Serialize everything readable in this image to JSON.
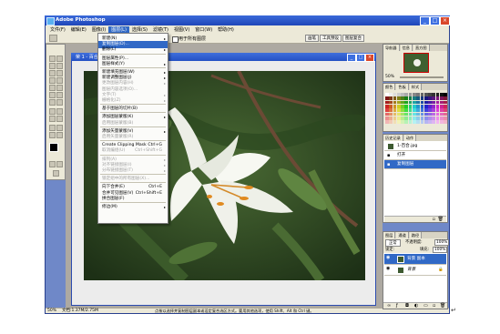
{
  "window": {
    "title": "Adobe Photoshop",
    "controls": [
      "_",
      "□",
      "×"
    ]
  },
  "menubar": {
    "items": [
      "文件(F)",
      "编辑(E)",
      "图像(I)",
      "图层(L)",
      "选择(S)",
      "滤镜(T)",
      "视图(V)",
      "窗口(W)",
      "帮助(H)"
    ],
    "active_index": 3
  },
  "options_bar": {
    "checkbox_label": "用于所有图层",
    "tabs": [
      "画笔",
      "工具预设",
      "图层复合"
    ]
  },
  "document": {
    "title": "荣 1 - 百合.jpg @ 50% (复制图层, RGB/8)"
  },
  "layer_menu": {
    "items": [
      {
        "label": "新建(N)",
        "arrow": true
      },
      {
        "label": "复制图层(D)...",
        "highlight": true
      },
      {
        "label": "删除(L)",
        "arrow": true
      },
      {
        "sep": true
      },
      {
        "label": "图层属性(P)..."
      },
      {
        "label": "图层样式(Y)",
        "arrow": true
      },
      {
        "sep": true
      },
      {
        "label": "新建填充图层(W)",
        "arrow": true
      },
      {
        "label": "新建调整图层(J)",
        "arrow": true
      },
      {
        "label": "更改图层内容(H)",
        "arrow": true,
        "disabled": true
      },
      {
        "label": "图层内容选项(O)...",
        "disabled": true
      },
      {
        "label": "文字(T)",
        "arrow": true,
        "disabled": true
      },
      {
        "label": "栅格化(Z)",
        "arrow": true,
        "disabled": true
      },
      {
        "sep": true
      },
      {
        "label": "基于图层的切片(B)"
      },
      {
        "sep": true
      },
      {
        "label": "添加图层蒙版(K)",
        "arrow": true
      },
      {
        "label": "启用图层蒙版(B)",
        "disabled": true
      },
      {
        "sep": true
      },
      {
        "label": "添加矢量蒙版(V)",
        "arrow": true
      },
      {
        "label": "启用矢量蒙版(R)",
        "disabled": true
      },
      {
        "sep": true
      },
      {
        "label": "Create Clipping Mask",
        "shortcut": "Ctrl+G"
      },
      {
        "label": "取消编组(U)",
        "shortcut": "Ctrl+Shift+G",
        "disabled": true
      },
      {
        "sep": true
      },
      {
        "label": "排列(A)",
        "arrow": true,
        "disabled": true
      },
      {
        "label": "对齐链接图层(I)",
        "arrow": true,
        "disabled": true
      },
      {
        "label": "分布链接图层(T)",
        "arrow": true,
        "disabled": true
      },
      {
        "sep": true
      },
      {
        "label": "锁定组中的所有图层(X)...",
        "disabled": true
      },
      {
        "sep": true
      },
      {
        "label": "向下合并(E)",
        "shortcut": "Ctrl+E"
      },
      {
        "label": "合并可见图层(V)",
        "shortcut": "Ctrl+Shift+E"
      },
      {
        "label": "拼合图层(F)"
      },
      {
        "sep": true
      },
      {
        "label": "修边(M)",
        "arrow": true
      }
    ]
  },
  "status_bar": {
    "zoom": "50%",
    "doc_info": "文档:1.37M/2.75M",
    "hint": "点按以选择并复制图层副本或设定复合选区方式。要用其他选项，使用 Shift、Alt 和 Ctrl 键。"
  },
  "navigator_panel": {
    "tabs": [
      "导航器",
      "信息",
      "直方图"
    ],
    "zoom": "50%"
  },
  "swatches_panel": {
    "tabs": [
      "颜色",
      "色板",
      "样式"
    ]
  },
  "history_panel": {
    "tabs": [
      "历史记录",
      "动作"
    ],
    "source": "1-百合.jpg",
    "steps": [
      "打开",
      "复制图层"
    ]
  },
  "layers_panel": {
    "tabs": [
      "图层",
      "通道",
      "路径"
    ],
    "blend_mode": "正常",
    "opacity_label": "不透明度:",
    "opacity": "100%",
    "lock_label": "锁定:",
    "fill_label": "填充:",
    "fill": "100%",
    "layers": [
      {
        "name": "背景 副本",
        "selected": true
      },
      {
        "name": "背景",
        "locked": true
      }
    ]
  },
  "colors": {
    "title_blue": "#2350c4",
    "highlight": "#3169c6",
    "chrome": "#ece9d8"
  }
}
